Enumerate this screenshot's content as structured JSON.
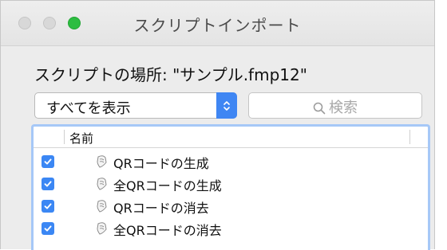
{
  "window": {
    "title": "スクリプトインポート"
  },
  "location_label": "スクリプトの場所: \"サンプル.fmp12\"",
  "filter": {
    "selected": "すべてを表示"
  },
  "search": {
    "placeholder": "検索"
  },
  "list": {
    "header": "名前",
    "rows": [
      {
        "label": "QRコードの生成",
        "checked": true
      },
      {
        "label": "全QRコードの生成",
        "checked": true
      },
      {
        "label": "QRコードの消去",
        "checked": true
      },
      {
        "label": "全QRコードの消去",
        "checked": true
      }
    ]
  },
  "colors": {
    "accent": "#3b87f4",
    "focus_ring": "#a6c8f7",
    "zoom": "#2dbd41"
  }
}
